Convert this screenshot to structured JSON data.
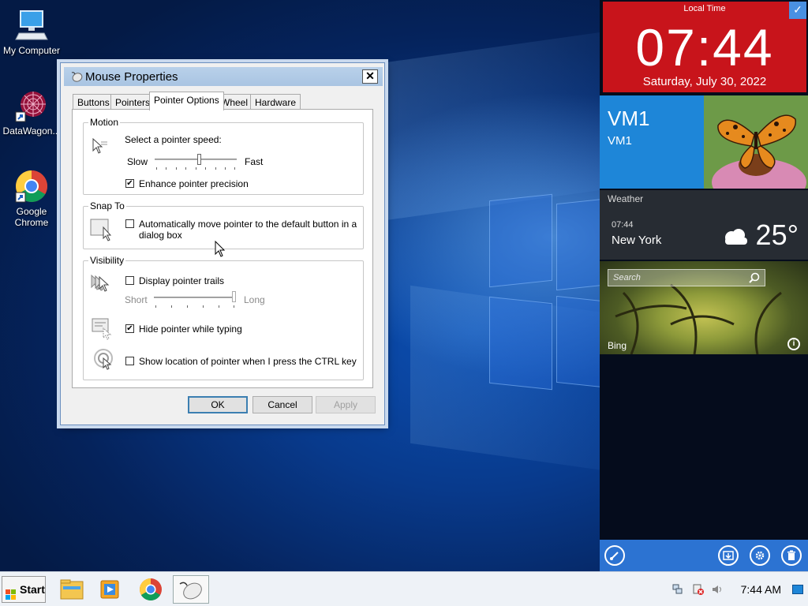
{
  "desktop": {
    "icons": [
      {
        "label": "My Computer"
      },
      {
        "label": "DataWagon..."
      },
      {
        "label": "Google Chrome"
      }
    ]
  },
  "dialog": {
    "title": "Mouse Properties",
    "close_glyph": "✕",
    "tabs": [
      {
        "label": "Buttons"
      },
      {
        "label": "Pointers"
      },
      {
        "label": "Pointer Options"
      },
      {
        "label": "Wheel"
      },
      {
        "label": "Hardware"
      }
    ],
    "active_tab": "Pointer Options",
    "motion": {
      "group_title": "Motion",
      "speed_label": "Select a pointer speed:",
      "slow_label": "Slow",
      "fast_label": "Fast",
      "speed_fraction": 0.55,
      "precision_label": "Enhance pointer precision",
      "precision_checked": true
    },
    "snap_to": {
      "group_title": "Snap To",
      "label_line1": "Automatically move pointer to the default button in a",
      "label_line2": "dialog box",
      "checked": false
    },
    "visibility": {
      "group_title": "Visibility",
      "trails_label": "Display pointer trails",
      "trails_checked": false,
      "short_label": "Short",
      "long_label": "Long",
      "trail_fraction": 1.0,
      "hide_label": "Hide pointer while typing",
      "hide_checked": true,
      "ctrl_label": "Show location of pointer when I press the CTRL key",
      "ctrl_checked": false
    },
    "buttons": {
      "ok": "OK",
      "cancel": "Cancel",
      "apply": "Apply"
    }
  },
  "side_panel": {
    "clock": {
      "label": "Local Time",
      "time": "07:44",
      "date": "Saturday, July 30, 2022"
    },
    "vm": {
      "name": "VM1",
      "subtitle": "VM1"
    },
    "weather": {
      "title": "Weather",
      "time": "07:44",
      "city": "New York",
      "temperature": "25°",
      "icon": "cloud-icon"
    },
    "bing": {
      "search_placeholder": "Search",
      "label": "Bing"
    },
    "bottom_icons": [
      "paint-brush-icon",
      "download-icon",
      "gear-icon",
      "trash-icon"
    ]
  },
  "taskbar": {
    "start_label": "Start",
    "apps": [
      "file-explorer-icon",
      "media-player-icon",
      "chrome-icon",
      "mouse-icon"
    ],
    "clock": "7:44 AM",
    "tray_icons": [
      "network-icon",
      "security-alert-icon",
      "volume-icon"
    ]
  },
  "colors": {
    "clock_tile": "#c8141b",
    "vm_tile": "#1e86d8",
    "panel_bottom": "#2c73d2",
    "weather_tile": "#272c33"
  }
}
